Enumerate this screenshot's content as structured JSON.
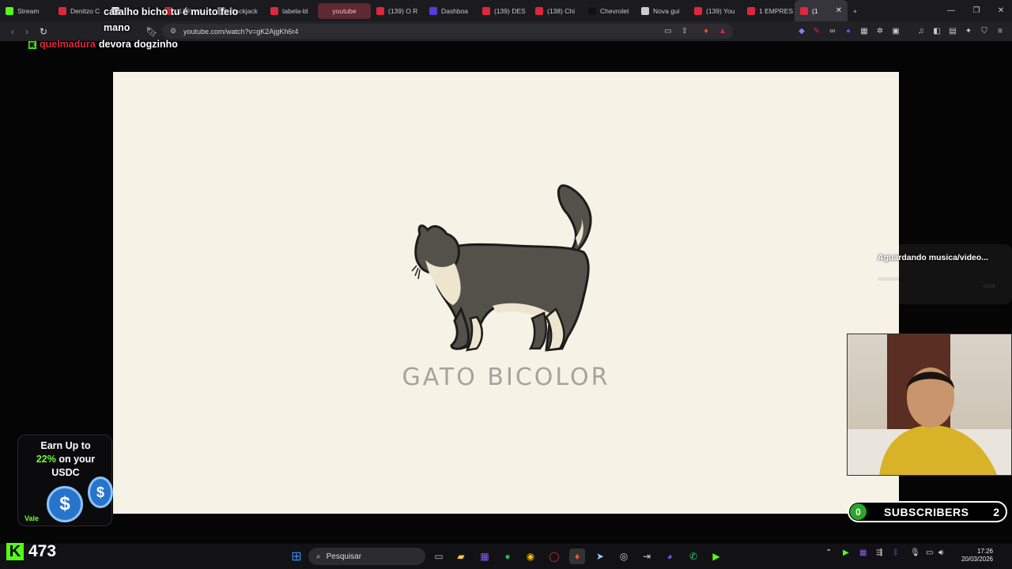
{
  "browser": {
    "tabs": [
      {
        "label": "Stream",
        "color": "#53fc18"
      },
      {
        "label": "Denitzo C",
        "color": "#e0263d"
      },
      {
        "label": "",
        "color": "#ffffff"
      },
      {
        "label": "(139) wil",
        "color": "#e0263d"
      },
      {
        "label": "Blackjack",
        "color": "#888888"
      },
      {
        "label": "tabela-bl",
        "color": "#e0263d"
      },
      {
        "label": "youtube",
        "color": "#e0263d",
        "highlight": true
      },
      {
        "label": "(139) O R",
        "color": "#e0263d"
      },
      {
        "label": "Dashboa",
        "color": "#5a3ad8"
      },
      {
        "label": "(139) DES",
        "color": "#e0263d"
      },
      {
        "label": "(138) Chi",
        "color": "#e0263d"
      },
      {
        "label": "Chevrolet",
        "color": "#111111"
      },
      {
        "label": "Nova gui",
        "color": "#cccccc"
      },
      {
        "label": "(139) You",
        "color": "#e0263d"
      },
      {
        "label": "1 EMPRES",
        "color": "#e0263d"
      },
      {
        "label": "(1",
        "color": "#e0263d",
        "active": true
      }
    ],
    "url": "youtube.com/watch?v=gK2AjgKh6r4",
    "new_tab": "+",
    "close_tab": "✕"
  },
  "chat": {
    "lines": [
      {
        "text": "caralho bicho tu é muito feio"
      },
      {
        "text": "mano"
      },
      {
        "user": "quelmadura",
        "text": "devora dogzinho"
      }
    ]
  },
  "video": {
    "title": "GATO BICOLOR"
  },
  "music_widget": {
    "text": "Aguardando musica/video...",
    "time": "00:00"
  },
  "ad": {
    "line1": "Earn Up to",
    "line2_highlight": "22%",
    "line2_rest": " on your",
    "line3": "USDC",
    "footer": "Vale"
  },
  "subscribers": {
    "left_count": "0",
    "label": "SUBSCRIBERS",
    "right_count": "2"
  },
  "viewers": {
    "count": "473"
  },
  "taskbar": {
    "search_placeholder": "Pesquisar",
    "time": "17:26",
    "date": "20/03/2026"
  }
}
